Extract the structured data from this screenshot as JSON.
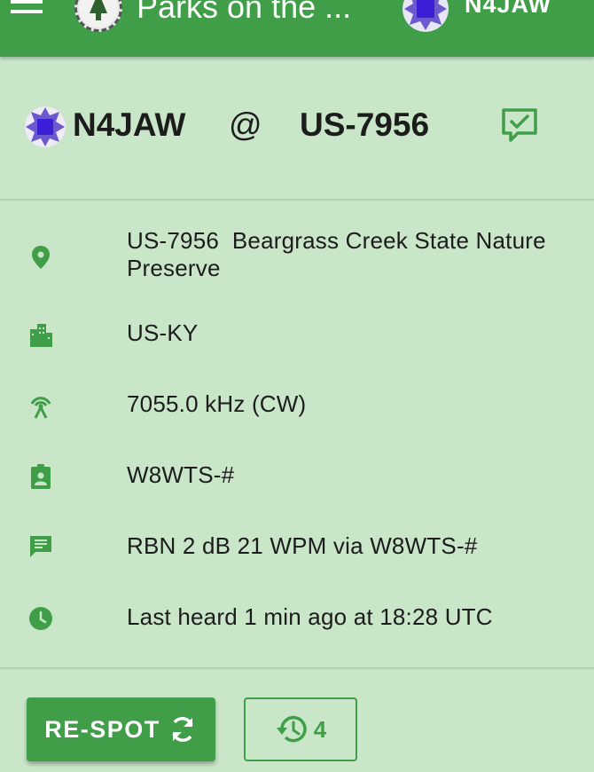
{
  "appbar": {
    "title": "Parks on the ...",
    "user_callsign": "N4JAW",
    "color": "#3f9e47"
  },
  "spot": {
    "activator": "N4JAW",
    "at": "@",
    "park": "US-7956"
  },
  "details": {
    "location_ref": "US-7956",
    "location_name": "Beargrass Creek State Nature Preserve",
    "region": "US-KY",
    "frequency": "7055.0 kHz (CW)",
    "spotter": "W8WTS-#",
    "comment": "RBN 2 dB 21 WPM via W8WTS-#",
    "last_heard": "Last heard 1 min ago at 18:28 UTC"
  },
  "actions": {
    "respot_label": "RE-SPOT",
    "history_count": "4"
  },
  "icons": {
    "menu": "menu-icon",
    "location": "map-marker-icon",
    "region": "city-icon",
    "frequency": "antenna-icon",
    "spotter": "badge-icon",
    "comment": "message-icon",
    "time": "clock-icon",
    "respot": "refresh-icon",
    "history": "history-icon",
    "add_comment": "comment-check-icon"
  }
}
